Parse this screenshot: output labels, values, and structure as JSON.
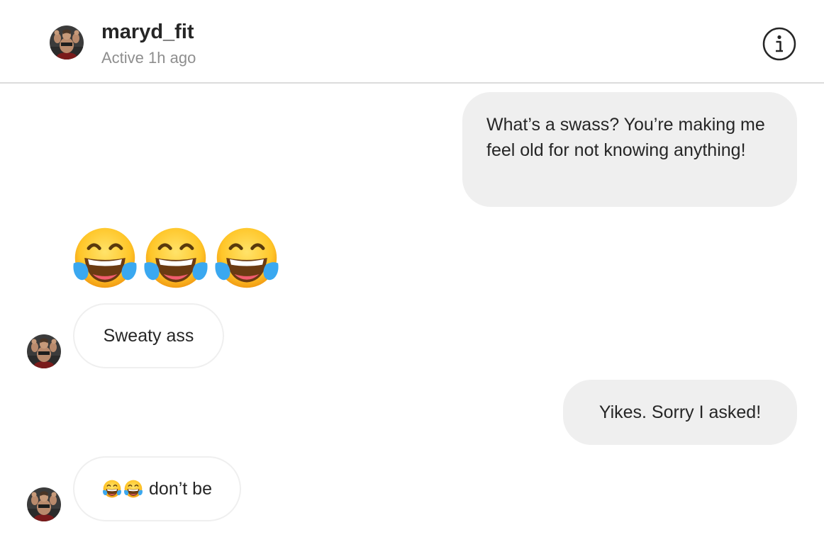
{
  "header": {
    "username": "maryd_fit",
    "status": "Active 1h ago",
    "info_icon": "info-circle-icon"
  },
  "messages": [
    {
      "sender": "me",
      "text": "What’s a swass? You’re making me feel old for not knowing anything!"
    },
    {
      "sender": "them",
      "emoji": "face-with-tears-of-joy",
      "count": 3
    },
    {
      "sender": "them",
      "text": "Sweaty ass"
    },
    {
      "sender": "me",
      "text": "Yikes. Sorry I asked!"
    },
    {
      "sender": "them",
      "emoji": "face-with-tears-of-joy",
      "emoji_count": 2,
      "text": "don’t be"
    }
  ],
  "colors": {
    "outgoing_bubble": "#efefef",
    "incoming_border": "#efefef",
    "text": "#262626",
    "muted_text": "#8e8e8e",
    "divider": "#dbdbdb"
  }
}
